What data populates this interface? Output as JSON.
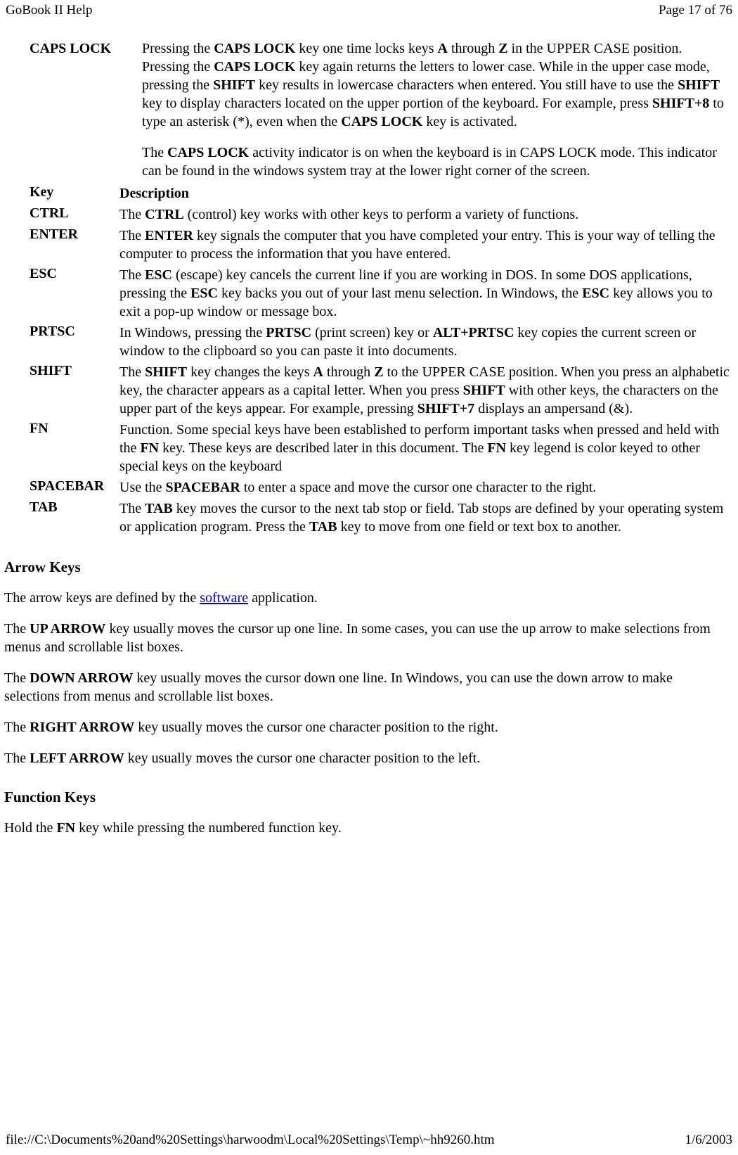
{
  "header": {
    "title": "GoBook II Help",
    "page": "Page 17 of 76"
  },
  "capslock": {
    "key": "CAPS LOCK",
    "p1_a": "Pressing the ",
    "p1_b": "CAPS LOCK",
    "p1_c": " key one time locks keys ",
    "p1_d": "A",
    "p1_e": " through ",
    "p1_f": "Z",
    "p1_g": " in the UPPER CASE position. Pressing the ",
    "p1_h": "CAPS LOCK",
    "p1_i": " key again returns the letters to lower case. While in the upper case mode, pressing the ",
    "p1_j": "SHIFT",
    "p1_k": " key results in lowercase characters when entered. You still have to use the ",
    "p1_l": "SHIFT",
    "p1_m": " key to display characters located on the upper portion of the keyboard. For example, press ",
    "p1_n": "SHIFT+8",
    "p1_o": " to type an asterisk (*), even when the ",
    "p1_p": "CAPS LOCK",
    "p1_q": " key is activated.",
    "p2_a": "The ",
    "p2_b": "CAPS LOCK",
    "p2_c": " activity indicator is on when the keyboard is in CAPS LOCK mode. This indicator can be found in the windows system tray at the lower right corner of the screen."
  },
  "table": {
    "h_key": "Key",
    "h_desc": "Description",
    "ctrl_k": "CTRL",
    "ctrl_a": "The ",
    "ctrl_b": "CTRL",
    "ctrl_c": " (control) key works with other keys to perform a variety of functions.",
    "enter_k": "ENTER",
    "enter_a": "The ",
    "enter_b": "ENTER",
    "enter_c": " key signals the computer that you have completed your entry. This is your way of telling the computer to process the information that you have entered.",
    "esc_k": "ESC",
    "esc_a": "The ",
    "esc_b": "ESC",
    "esc_c": " (escape) key cancels the current line if you are working in DOS. In some DOS applications, pressing the ",
    "esc_d": "ESC",
    "esc_e": " key backs you out of your last menu selection. In Windows, the ",
    "esc_f": "ESC",
    "esc_g": " key allows you to exit a pop-up window or message box.",
    "prtsc_k": "PRTSC",
    "prtsc_a": "In Windows, pressing the ",
    "prtsc_b": "PRTSC",
    "prtsc_c": " (print screen) key or ",
    "prtsc_d": "ALT+PRTSC",
    "prtsc_e": " key copies the current screen or window to the clipboard so you can paste it into documents.",
    "shift_k": "SHIFT",
    "shift_a": "The ",
    "shift_b": "SHIFT",
    "shift_c": " key changes the keys ",
    "shift_d": "A",
    "shift_e": " through ",
    "shift_f": "Z",
    "shift_g": " to the UPPER CASE position. When you press an alphabetic key, the character appears as a capital letter. When you press ",
    "shift_h": "SHIFT",
    "shift_i": " with other keys, the characters on the upper part of the keys appear. For example, pressing ",
    "shift_j": "SHIFT+7",
    "shift_k2": " displays an ampersand (&).",
    "fn_k": "FN",
    "fn_a": "Function. Some special keys have been established to perform important tasks when pressed and held with the ",
    "fn_b": "FN",
    "fn_c": " key. These keys are described later in this document.  The ",
    "fn_d": "FN",
    "fn_e": " key legend is color keyed to other special keys on the keyboard",
    "space_k": "SPACEBAR",
    "space_a": "Use the ",
    "space_b": "SPACEBAR",
    "space_c": " to enter a space and move the cursor one character to the right.",
    "tab_k": "TAB",
    "tab_a": "The ",
    "tab_b": "TAB",
    "tab_c": " key moves the cursor to the next tab stop or field. Tab stops are defined by your operating system or application program. Press the ",
    "tab_d": "TAB",
    "tab_e": " key to move from one field or text box to another."
  },
  "arrow": {
    "heading": "Arrow Keys",
    "intro_a": "The arrow keys are defined by the ",
    "intro_link": "software",
    "intro_b": " application.",
    "up_a": "The ",
    "up_b": "UP ARROW",
    "up_c": " key usually moves the cursor up one line. In some cases, you can use the up arrow to make selections from menus and scrollable list boxes.",
    "down_a": "The ",
    "down_b": "DOWN ARROW",
    "down_c": " key usually moves the cursor down one line. In Windows, you can use the down arrow to make selections from menus and scrollable list boxes.",
    "right_a": "The ",
    "right_b": "RIGHT ARROW",
    "right_c": " key usually moves the cursor one character position to the right.",
    "left_a": "The ",
    "left_b": "LEFT ARROW",
    "left_c": " key usually moves the cursor one character position to the left."
  },
  "func": {
    "heading": "Function Keys",
    "p_a": "Hold the ",
    "p_b": "FN",
    "p_c": " key while pressing the numbered function key."
  },
  "footer": {
    "path": "file://C:\\Documents%20and%20Settings\\harwoodm\\Local%20Settings\\Temp\\~hh9260.htm",
    "date": "1/6/2003"
  }
}
